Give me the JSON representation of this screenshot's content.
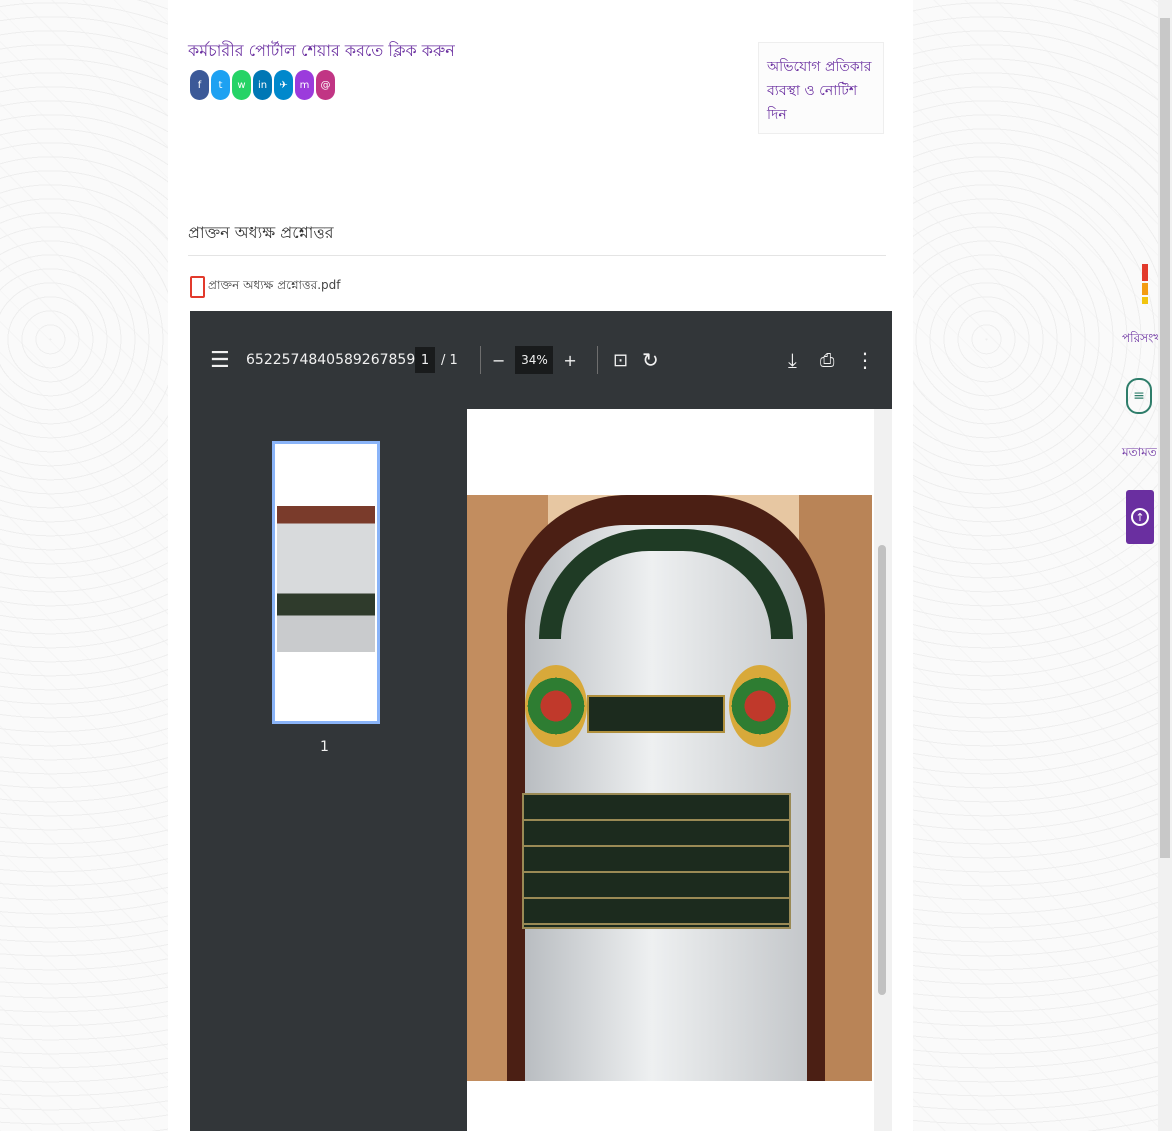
{
  "share": {
    "text": "কর্মচারীর পোর্টাল শেয়ার করতে ক্লিক করুন"
  },
  "social_icons": [
    {
      "name": "facebook-icon",
      "color": "#3b5998",
      "glyph": "f"
    },
    {
      "name": "twitter-icon",
      "color": "#1da1f2",
      "glyph": "t"
    },
    {
      "name": "whatsapp-icon",
      "color": "#25d366",
      "glyph": "w"
    },
    {
      "name": "linkedin-icon",
      "color": "#0077b5",
      "glyph": "in"
    },
    {
      "name": "telegram-icon",
      "color": "#0088cc",
      "glyph": "✈"
    },
    {
      "name": "messenger-icon",
      "color": "#9b3bdc",
      "glyph": "m"
    },
    {
      "name": "email-icon",
      "color": "#c13584",
      "glyph": "@"
    }
  ],
  "notice": {
    "text": "অভিযোগ প্রতিকার ব্যবস্থা ও নোটিশ দিন"
  },
  "section": {
    "title": "প্রাক্তন অধ্যক্ষ প্রশ্নোত্তর"
  },
  "file": {
    "name": "প্রাক্তন অধ্যক্ষ প্রশ্নোত্তর.pdf"
  },
  "viewer": {
    "file_name": "6522574840589267859...",
    "page_current": "1",
    "page_total": "/ 1",
    "zoom": "34%",
    "thumb_page": "1"
  },
  "widgets": {
    "stats_label": "পরিসংখ্যান",
    "chat_label": "মতামত"
  },
  "colors": {
    "accent": "#6a2fa0",
    "toolbar": "#323639"
  }
}
